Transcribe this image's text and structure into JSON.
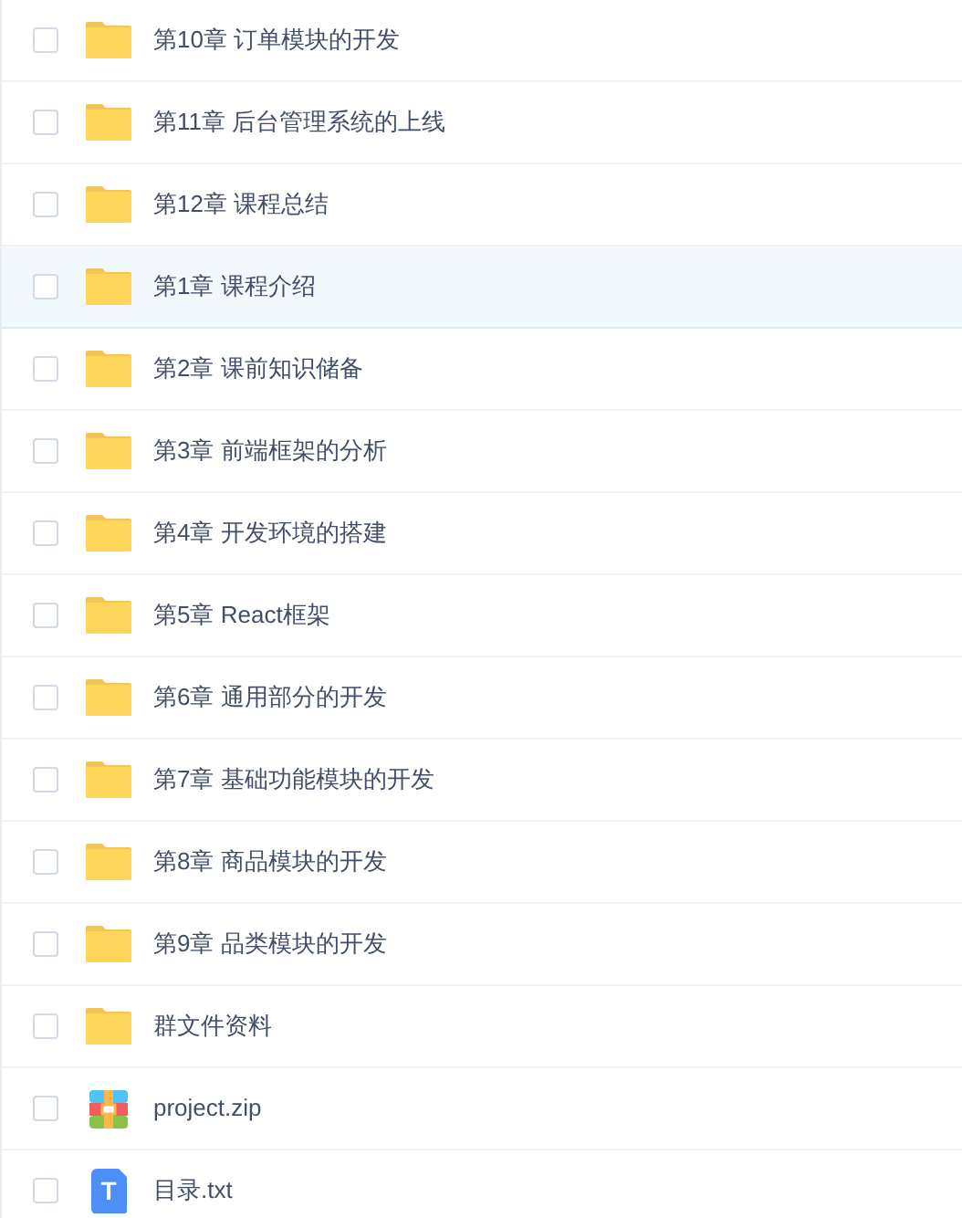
{
  "files": [
    {
      "name": "第10章 订单模块的开发",
      "kind": "folder",
      "checked": false,
      "highlighted": false
    },
    {
      "name": "第11章 后台管理系统的上线",
      "kind": "folder",
      "checked": false,
      "highlighted": false
    },
    {
      "name": "第12章 课程总结",
      "kind": "folder",
      "checked": false,
      "highlighted": false
    },
    {
      "name": "第1章 课程介绍",
      "kind": "folder",
      "checked": false,
      "highlighted": true
    },
    {
      "name": "第2章 课前知识储备",
      "kind": "folder",
      "checked": false,
      "highlighted": false
    },
    {
      "name": "第3章 前端框架的分析",
      "kind": "folder",
      "checked": false,
      "highlighted": false
    },
    {
      "name": "第4章 开发环境的搭建",
      "kind": "folder",
      "checked": false,
      "highlighted": false
    },
    {
      "name": "第5章 React框架",
      "kind": "folder",
      "checked": false,
      "highlighted": false
    },
    {
      "name": "第6章 通用部分的开发",
      "kind": "folder",
      "checked": false,
      "highlighted": false
    },
    {
      "name": "第7章 基础功能模块的开发",
      "kind": "folder",
      "checked": false,
      "highlighted": false
    },
    {
      "name": "第8章 商品模块的开发",
      "kind": "folder",
      "checked": false,
      "highlighted": false
    },
    {
      "name": "第9章 品类模块的开发",
      "kind": "folder",
      "checked": false,
      "highlighted": false
    },
    {
      "name": "群文件资料",
      "kind": "folder",
      "checked": false,
      "highlighted": false
    },
    {
      "name": "project.zip",
      "kind": "archive",
      "checked": false,
      "highlighted": false
    },
    {
      "name": "目录.txt",
      "kind": "text",
      "icon_label": "T",
      "checked": false,
      "highlighted": false
    }
  ]
}
